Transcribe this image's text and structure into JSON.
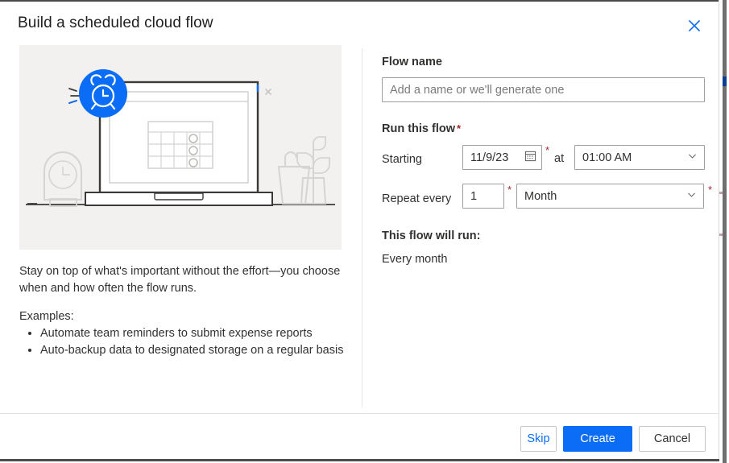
{
  "dialog": {
    "title": "Build a scheduled cloud flow",
    "close_icon": "close-icon"
  },
  "left_pane": {
    "illustration_alt": "laptop-with-calendar-and-alarm-clock-illustration",
    "lead_text": "Stay on top of what's important without the effort—you choose when and how often the flow runs.",
    "examples_label": "Examples:",
    "examples": [
      "Automate team reminders to submit expense reports",
      "Auto-backup data to designated storage on a regular basis"
    ]
  },
  "form": {
    "flow_name_label": "Flow name",
    "flow_name_value": "",
    "flow_name_placeholder": "Add a name or we'll generate one",
    "run_this_flow_label": "Run this flow",
    "required_marker": "*",
    "starting_label": "Starting",
    "start_date": "11/9/23",
    "at_label": "at",
    "start_time": "01:00 AM",
    "repeat_every_label": "Repeat every",
    "repeat_count": "1",
    "repeat_unit": "Month",
    "calendar_icon": "calendar-icon",
    "chevron_icon": "chevron-down-icon"
  },
  "summary": {
    "label": "This flow will run:",
    "value": "Every month"
  },
  "footer": {
    "skip_label": "Skip",
    "create_label": "Create",
    "cancel_label": "Cancel"
  },
  "colors": {
    "accent_blue": "#0b6cf5",
    "required_red": "#a4262c",
    "illustration_bg": "#f2f1f0",
    "border_gray": "#a19f9d"
  }
}
